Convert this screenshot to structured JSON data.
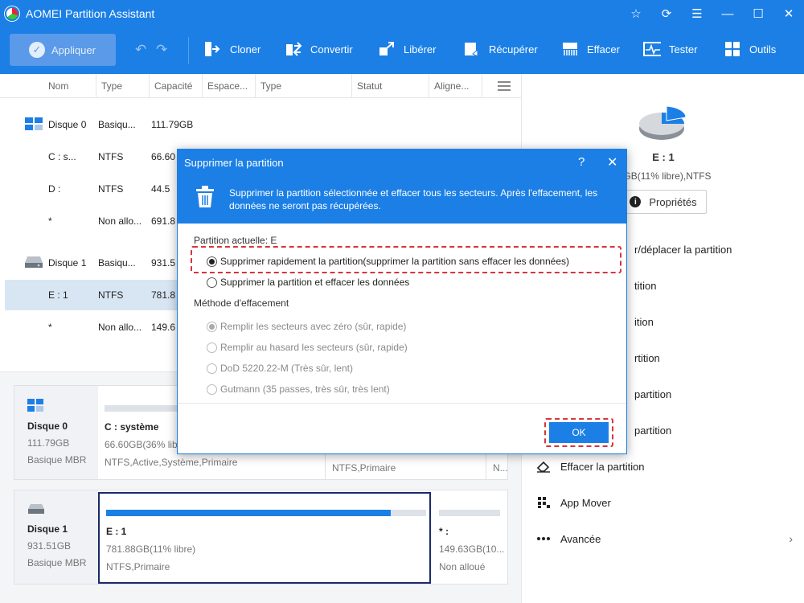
{
  "window": {
    "title": "AOMEI Partition Assistant"
  },
  "toolbar": {
    "apply": "Appliquer",
    "items": [
      "Cloner",
      "Convertir",
      "Libérer",
      "Récupérer",
      "Effacer",
      "Tester",
      "Outils"
    ]
  },
  "list": {
    "columns": [
      "Nom",
      "Type",
      "Capacité",
      "Espace...",
      "Type",
      "Statut",
      "Aligne..."
    ],
    "rows": [
      {
        "name": "Disque 0",
        "type": "Basiqu...",
        "cap": "111.79GB"
      },
      {
        "name": "C : s...",
        "type": "NTFS",
        "cap": "66.60"
      },
      {
        "name": "D :",
        "type": "NTFS",
        "cap": "44.5"
      },
      {
        "name": "*",
        "type": "Non allo...",
        "cap": "691.8"
      },
      {
        "name": "Disque 1",
        "type": "Basiqu...",
        "cap": "931.5"
      },
      {
        "name": "E : 1",
        "type": "NTFS",
        "cap": "781.8"
      },
      {
        "name": "*",
        "type": "Non allo...",
        "cap": "149.6"
      }
    ]
  },
  "diskmap": {
    "disk0": {
      "name": "Disque 0",
      "size": "111.79GB",
      "kind": "Basique MBR",
      "parts": [
        {
          "title": "C : système",
          "size": "66.60GB(36% lib",
          "fs": "NTFS,Active,Système,Primaire"
        },
        {
          "fs": "NTFS,Primaire"
        },
        {
          "fs": "N..."
        }
      ]
    },
    "disk1": {
      "name": "Disque 1",
      "size": "931.51GB",
      "kind": "Basique MBR",
      "parts": [
        {
          "title": "E : 1",
          "size": "781.88GB(11% libre)",
          "fs": "NTFS,Primaire",
          "used": 0.89
        },
        {
          "title": "* :",
          "size": "149.63GB(10...",
          "fs": "Non alloué"
        }
      ]
    }
  },
  "right": {
    "title": "E : 1",
    "sub": "8 GB(11% libre),NTFS",
    "props": "Propriétés",
    "ops": [
      "r/déplacer la partition",
      "tition",
      "ition",
      "rtition",
      "partition",
      "partition",
      "Effacer la partition",
      "App Mover",
      "Avancée"
    ]
  },
  "dialog": {
    "title": "Supprimer la partition",
    "help": "?",
    "close": "✕",
    "desc": "Supprimer la partition sélectionnée et effacer tous les secteurs. Après l'effacement, les données ne seront pas récupérées.",
    "current_label": "Partition actuelle: E",
    "opt_quick": "Supprimer rapidement la partition(supprimer la partition sans effacer les données)",
    "opt_wipe": "Supprimer la partition et effacer les données",
    "method_label": "Méthode d'effacement",
    "methods": [
      "Remplir les secteurs avec zéro (sûr, rapide)",
      "Remplir au hasard les secteurs (sûr, rapide)",
      "DoD 5220.22-M (Très sûr, lent)",
      "Gutmann (35 passes, très sûr, très lent)"
    ],
    "ok": "OK"
  }
}
